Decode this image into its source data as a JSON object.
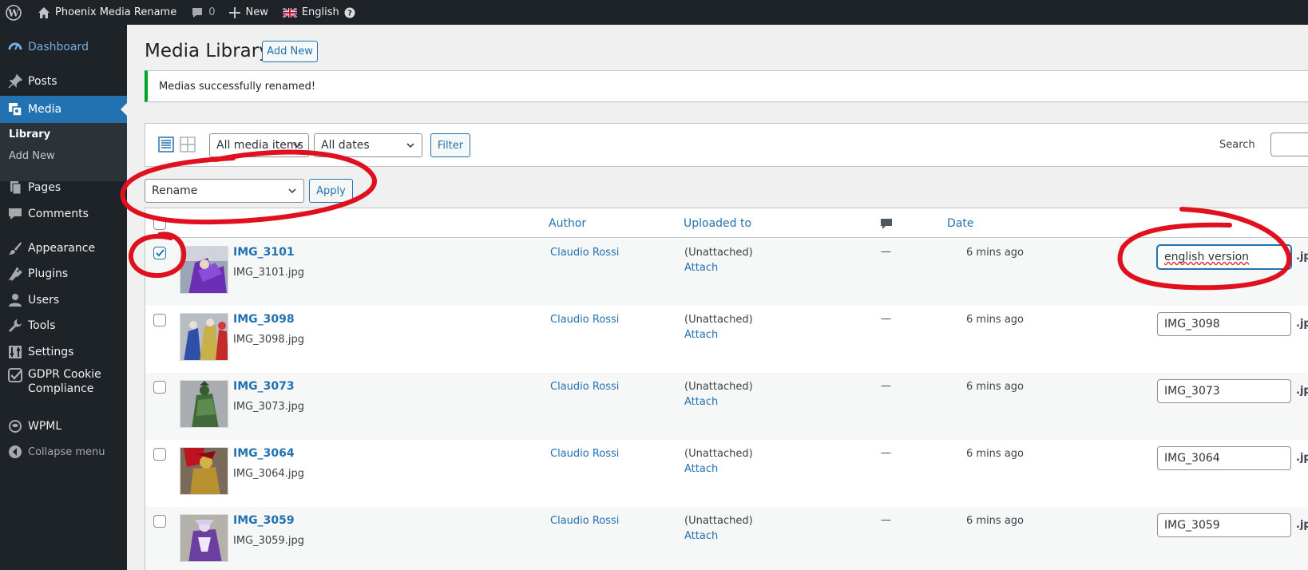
{
  "adminbar": {
    "site_name": "Phoenix Media Rename",
    "comments_count": "0",
    "new_label": "New",
    "language": "English"
  },
  "sidebar": {
    "items": [
      {
        "label": "Dashboard",
        "icon": "dashboard-icon"
      },
      {
        "label": "Posts",
        "icon": "pin-icon"
      },
      {
        "label": "Media",
        "icon": "media-icon"
      },
      {
        "label": "Pages",
        "icon": "page-icon"
      },
      {
        "label": "Comments",
        "icon": "comment-icon"
      },
      {
        "label": "Appearance",
        "icon": "brush-icon"
      },
      {
        "label": "Plugins",
        "icon": "plug-icon"
      },
      {
        "label": "Users",
        "icon": "user-icon"
      },
      {
        "label": "Tools",
        "icon": "wrench-icon"
      },
      {
        "label": "Settings",
        "icon": "settings-icon"
      },
      {
        "label": "GDPR Cookie",
        "label2": "Compliance",
        "icon": "check-shield-icon"
      },
      {
        "label": "WPML",
        "icon": "wpml-icon"
      },
      {
        "label": "Collapse menu",
        "icon": "collapse-icon"
      }
    ],
    "submenu": {
      "library": "Library",
      "add_new": "Add New"
    }
  },
  "main": {
    "title": "Media Library",
    "add_new": "Add New",
    "notice": "Medias successfully renamed!",
    "filter_media": "All media items",
    "filter_dates": "All dates",
    "filter_button": "Filter",
    "search_label": "Search",
    "bulk_action": "Rename",
    "apply_button": "Apply"
  },
  "table": {
    "headers": {
      "author": "Author",
      "uploaded_to": "Uploaded to",
      "date": "Date"
    },
    "rows": [
      {
        "title": "IMG_3101",
        "file": "IMG_3101.jpg",
        "author": "Claudio Rossi",
        "parent": "(Unattached)",
        "attach": "Attach",
        "comments": "—",
        "date": "6 mins ago",
        "new_name": "english version",
        "ext": ".jpg",
        "checked": true
      },
      {
        "title": "IMG_3098",
        "file": "IMG_3098.jpg",
        "author": "Claudio Rossi",
        "parent": "(Unattached)",
        "attach": "Attach",
        "comments": "—",
        "date": "6 mins ago",
        "new_name": "IMG_3098",
        "ext": ".jpg",
        "checked": false
      },
      {
        "title": "IMG_3073",
        "file": "IMG_3073.jpg",
        "author": "Claudio Rossi",
        "parent": "(Unattached)",
        "attach": "Attach",
        "comments": "—",
        "date": "6 mins ago",
        "new_name": "IMG_3073",
        "ext": ".jpg",
        "checked": false
      },
      {
        "title": "IMG_3064",
        "file": "IMG_3064.jpg",
        "author": "Claudio Rossi",
        "parent": "(Unattached)",
        "attach": "Attach",
        "comments": "—",
        "date": "6 mins ago",
        "new_name": "IMG_3064",
        "ext": ".jpg",
        "checked": false
      },
      {
        "title": "IMG_3059",
        "file": "IMG_3059.jpg",
        "author": "Claudio Rossi",
        "parent": "(Unattached)",
        "attach": "Attach",
        "comments": "—",
        "date": "6 mins ago",
        "new_name": "IMG_3059",
        "ext": ".jpg",
        "checked": false
      }
    ]
  },
  "colors": {
    "accent": "#2271b1",
    "sidebar": "#1d2327",
    "success": "#00a32a",
    "annotation": "#e0101e"
  }
}
